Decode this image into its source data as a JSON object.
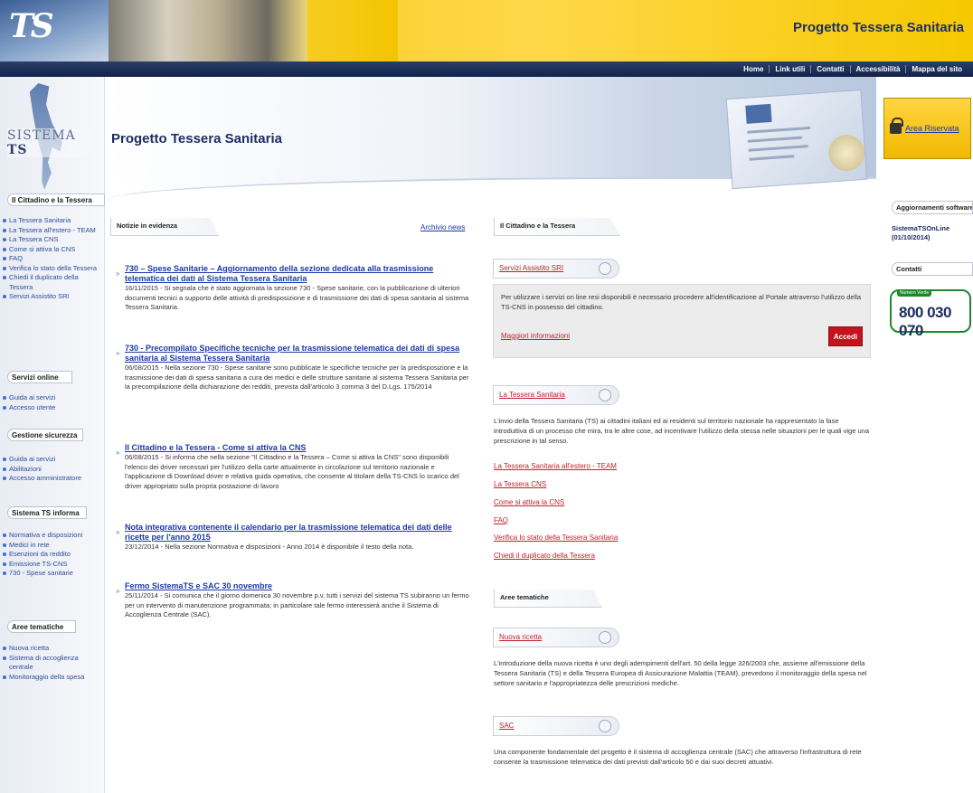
{
  "header": {
    "logo": "TS",
    "site_title": "Progetto Tessera Sanitaria"
  },
  "topnav": [
    "Home",
    "Link utili",
    "Contatti",
    "Accessibilità",
    "Mappa del sito"
  ],
  "sidebar": {
    "logo_text_light": "SISTEMA",
    "logo_text_bold": "TS",
    "sections": [
      {
        "title": "Il Cittadino e la Tessera",
        "items": [
          "La Tessera Sanitaria",
          "La Tessera all'estero - TEAM",
          "La Tessera CNS",
          "Come si attiva la CNS",
          "FAQ",
          "Verifica lo stato della Tessera",
          "Chiedi il duplicato della Tessera",
          "Servizi Assistito SRI"
        ]
      },
      {
        "title": "Servizi online",
        "items": [
          "Guida ai servizi",
          "Accesso utente"
        ]
      },
      {
        "title": "Gestione sicurezza",
        "items": [
          "Guida ai servizi",
          "Abilitazioni",
          "Accesso amministratore"
        ]
      },
      {
        "title": "Sistema TS informa",
        "items": [
          "Normativa e disposizioni",
          "Medici in rete",
          "Esenzioni da reddito",
          "Emissione TS-CNS",
          "730 - Spese sanitarie"
        ]
      },
      {
        "title": "Aree tematiche",
        "items": [
          "Nuova ricetta",
          "Sistema di accoglienza centrale",
          "Monitoraggio della spesa"
        ]
      }
    ]
  },
  "banner": {
    "title": "Progetto Tessera Sanitaria"
  },
  "news": {
    "tab_label": "Notizie in evidenza",
    "archive_label": "Archivio news",
    "items": [
      {
        "title": "730 – Spese Sanitarie – Aggiornamento della sezione dedicata alla trasmissione telematica dei dati al Sistema Tessera Sanitaria",
        "body": "16/11/2015 - Si segnala che è stato aggiornata la sezione 730 - Spese sanitarie, con la pubblicazione di ulteriori documenti tecnici a supporto delle attività di predisposizione e di trasmissione dei dati di spesa sanitaria al sistema Tessera Sanitaria."
      },
      {
        "title": "730 - Precompilato Specifiche tecniche per la trasmissione telematica dei dati di spesa sanitaria al Sistema Tessera Sanitaria",
        "body": "06/08/2015 - Nella sezione 730 - Spese sanitarie sono pubblicate le specifiche tecniche per la predisposizione e la trasmissione dei dati di spesa sanitaria a cura dei medici e delle strutture sanitarie al sistema Tessera Sanitaria per la precompilazione della dichiarazione dei redditi, prevista dall'articolo 3 comma 3 del D.Lgs. 175/2014"
      },
      {
        "title": "Il Cittadino e la Tessera - Come si attiva la CNS",
        "body": "06/08/2015 - Si informa che nella sezione \"Il Cittadino e la Tessera – Come si attiva la CNS\" sono disponibili l'elenco dei driver necessari per l'utilizzo della carte attualmente in circolazione sul territorio nazionale e l'applicazione di Download driver e relativa guida operativa, che consente al titolare della TS-CNS lo scarico del driver appropriato sulla propria postazione di lavoro"
      },
      {
        "title": "Nota integrativa contenente il calendario per la trasmissione telematica dei dati delle ricette per l'anno 2015",
        "body": "23/12/2014 - Nella sezione Normativa e disposizioni - Anno 2014 è disponibile il testo della nota."
      },
      {
        "title": "Fermo SistemaTS e SAC 30 novembre",
        "body": "25/11/2014 - Si comunica che il giorno domenica 30 novembre p.v. tutti i servizi del sistema TS subiranno un fermo per un intervento di manutenzione programmata; in particolare tale fermo interesserà anche il Sistema di Accoglienza Centrale (SAC)."
      }
    ]
  },
  "cittadino": {
    "tab_label": "Il Cittadino e la Tessera",
    "svc_tab": "Servizi Assistito SRI",
    "svc_text": "Per utilizzare i servizi on line resi disponibili è necessario procedere all'identificazione al Portale attraverso l'utilizzo della TS-CNS in possesso del cittadino.",
    "svc_more": "Maggiori informazioni",
    "accedi": "Accedi",
    "ts_tab": "La Tessera Sanitaria",
    "ts_text": "L'invio della Tessera Sanitaria (TS) ai cittadini italiani ed ai residenti sul territorio nazionale ha rappresentato la fase introduttiva di un processo che mira, tra le altre cose, ad incentivare l'utilizzo della stessa nelle situazioni per le quali vige una prescrizione in tal senso.",
    "links": [
      "La Tessera Sanitaria all'estero - TEAM",
      "La Tessera CNS",
      "Come si attiva la CNS",
      "FAQ",
      "Verifica lo stato della Tessera Sanitaria",
      "Chiedi il duplicato della Tessera"
    ]
  },
  "aree": {
    "tab_label": "Aree tematiche",
    "nuova_tab": "Nuova ricetta",
    "nuova_text": "L'introduzione della nuova ricetta è uno degli adempimenti dell'art. 50 della legge 326/2003 che, assieme all'emissione della Tessera Sanitaria (TS) e della Tessera Europea di Assicurazione Malattia (TEAM), prevedono il monitoraggio della spesa nel settore sanitario e l'appropriatezza delle prescrizioni mediche.",
    "sac_tab": "SAC",
    "sac_text": "Una componente fondamentale del progetto è il sistema di accoglienza centrale (SAC) che attraverso l'infrastruttura di rete consente la trasmissione telematica dei dati previsti dall'articolo 50 e dai suoi decreti attuativi."
  },
  "right": {
    "area_label": "Area Riservata",
    "updates_head": "Aggiornamenti software",
    "software": "SistemaTSOnLine (01/10/2014)",
    "contacts_head": "Contatti",
    "phone_tag": "Numero Verde",
    "phone": "800 030 070"
  }
}
